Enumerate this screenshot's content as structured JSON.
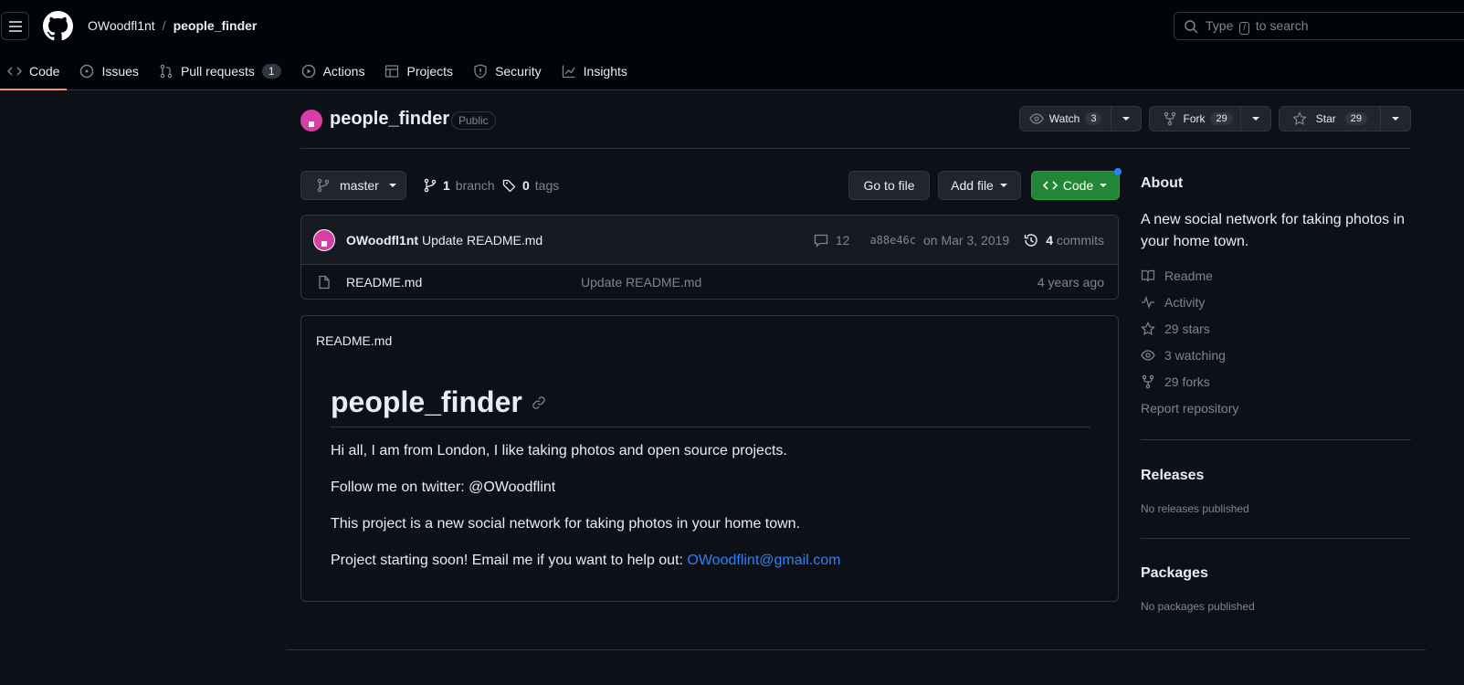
{
  "header": {
    "owner": "OWoodfl1nt",
    "separator": "/",
    "repo": "people_finder",
    "search_prefix": "Type",
    "search_key": "/",
    "search_suffix": "to search"
  },
  "tabs": [
    {
      "label": "Code",
      "icon": "code-icon"
    },
    {
      "label": "Issues",
      "icon": "issue-icon"
    },
    {
      "label": "Pull requests",
      "icon": "pull-request-icon",
      "count": "1"
    },
    {
      "label": "Actions",
      "icon": "play-icon"
    },
    {
      "label": "Projects",
      "icon": "table-icon"
    },
    {
      "label": "Security",
      "icon": "shield-icon"
    },
    {
      "label": "Insights",
      "icon": "graph-icon"
    }
  ],
  "repo": {
    "name": "people_finder",
    "visibility": "Public",
    "watch_label": "Watch",
    "watch_count": "3",
    "fork_label": "Fork",
    "fork_count": "29",
    "star_label": "Star",
    "star_count": "29"
  },
  "filebar": {
    "branch": "master",
    "branch_count": "1",
    "branch_label": "branch",
    "tag_count": "0",
    "tag_label": "tags",
    "go_to_file": "Go to file",
    "add_file": "Add file",
    "code": "Code"
  },
  "commit": {
    "author": "OWoodfl1nt",
    "message": "Update README.md",
    "comments": "12",
    "sha": "a88e46c",
    "date": "on Mar 3, 2019",
    "commit_count": "4",
    "commit_label": "commits"
  },
  "files": [
    {
      "name": "README.md",
      "commit": "Update README.md",
      "age": "4 years ago"
    }
  ],
  "readme": {
    "file_title": "README.md",
    "heading": "people_finder",
    "p1": "Hi all, I am from London, I like taking photos and open source projects.",
    "p2": "Follow me on twitter: @OWoodflint",
    "p3": "This project is a new social network for taking photos in your home town.",
    "p4": "Project starting soon! Email me if you want to help out:",
    "email": "OWoodflint@gmail.com"
  },
  "sidebar": {
    "about_title": "About",
    "about_desc": "A new social network for taking photos in your home town.",
    "links": [
      {
        "label": "Readme",
        "icon": "book-icon"
      },
      {
        "label": "Activity",
        "icon": "pulse-icon"
      },
      {
        "label": "29 stars",
        "icon": "star-icon"
      },
      {
        "label": "3 watching",
        "icon": "eye-icon"
      },
      {
        "label": "29 forks",
        "icon": "fork-icon"
      }
    ],
    "report": "Report repository",
    "releases_title": "Releases",
    "releases_text": "No releases published",
    "packages_title": "Packages",
    "packages_text": "No packages published"
  },
  "colors": {
    "background": "#0d1117",
    "header": "#010409",
    "border": "#30363d",
    "accent_tab": "#fd8c73",
    "green_button": "#238636",
    "link": "#2f81f7",
    "avatar": "#d63fa5"
  }
}
